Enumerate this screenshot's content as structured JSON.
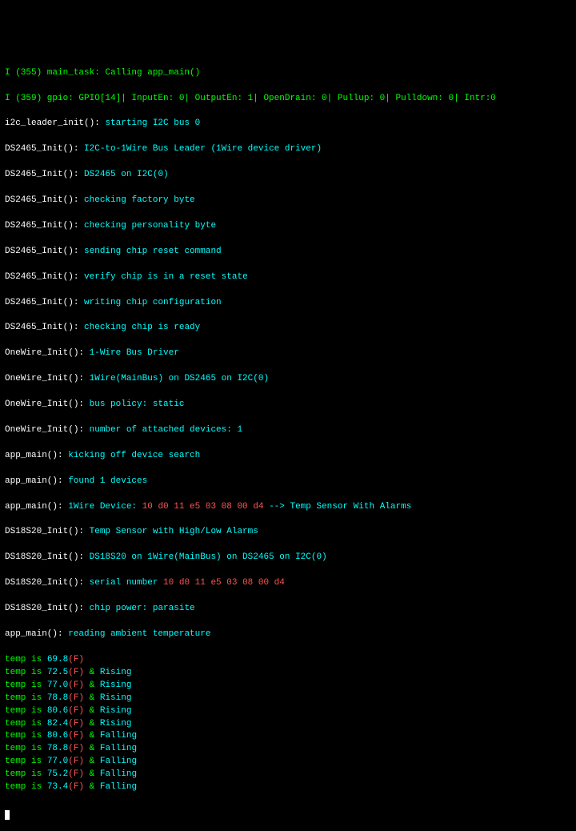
{
  "header": {
    "line1": "I (355) main_task: Calling app_main()",
    "line2": "I (359) gpio: GPIO[14]| InputEn: 0| OutputEn: 1| OpenDrain: 0| Pullup: 0| Pulldown: 0| Intr:0 "
  },
  "i2c": {
    "fn": "i2c_leader_init(): ",
    "msg": "starting I2C bus 0"
  },
  "ds2465": {
    "fn": "DS2465_Init(): ",
    "l1": "I2C-to-1Wire Bus Leader (1Wire device driver)",
    "l2": "DS2465 on I2C(0)",
    "l3": "checking factory byte",
    "l4": "checking personality byte",
    "l5": "sending chip reset command",
    "l6": "verify chip is in a reset state",
    "l7": "writing chip configuration",
    "l8": "checking chip is ready"
  },
  "onewire": {
    "fn": "OneWire_Init(): ",
    "l1": "1-Wire Bus Driver",
    "l2": "1Wire(MainBus) on DS2465 on I2C(0)",
    "l3": "bus policy: static",
    "l4": "number of attached devices: 1"
  },
  "appmain": {
    "fn": "app_main(): ",
    "l1": "kicking off device search",
    "l2": "found 1 devices",
    "l3a": "1Wire Device: ",
    "l3b": "10 d0 11 e5 03 08 00 d4",
    "l3c": " --> Temp Sensor With Alarms",
    "l4": "reading ambient temperature"
  },
  "ds18s20": {
    "fn": "DS18S20_Init(): ",
    "l1": "Temp Sensor with High/Low Alarms",
    "l2": "DS18S20 on 1Wire(MainBus) on DS2465 on I2C(0)",
    "l3a": "serial number ",
    "l3b": "10 d0 11 e5 03 08 00 d4",
    "l4": "chip power: parasite"
  },
  "temp_prefix": "temp is ",
  "amp": " & ",
  "f_suffix": "(F)",
  "readings": [
    {
      "value": "69.8",
      "trend": ""
    },
    {
      "value": "72.5",
      "trend": "Rising"
    },
    {
      "value": "77.0",
      "trend": "Rising"
    },
    {
      "value": "78.8",
      "trend": "Rising"
    },
    {
      "value": "80.6",
      "trend": "Rising"
    },
    {
      "value": "82.4",
      "trend": "Rising"
    },
    {
      "value": "80.6",
      "trend": "Falling"
    },
    {
      "value": "78.8",
      "trend": "Falling"
    },
    {
      "value": "77.0",
      "trend": "Falling"
    },
    {
      "value": "75.2",
      "trend": "Falling"
    },
    {
      "value": "73.4",
      "trend": "Falling"
    }
  ]
}
